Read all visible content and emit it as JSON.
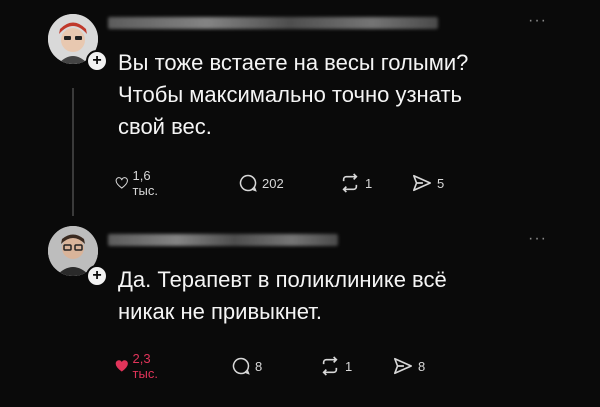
{
  "posts": [
    {
      "text_lines": [
        "Вы тоже встаете на весы голыми?",
        "Чтобы максимально точно узнать",
        "свой вес."
      ],
      "follow_symbol": "+",
      "more_symbol": "···",
      "actions": {
        "likes": "1,6 тыс.",
        "replies": "202",
        "reposts": "1",
        "shares": "5"
      },
      "liked": false
    },
    {
      "text_lines": [
        "Да. Терапевт в поликлинике всё",
        "никак не привыкнет."
      ],
      "follow_symbol": "+",
      "more_symbol": "···",
      "actions": {
        "likes": "2,3 тыс.",
        "replies": "8",
        "reposts": "1",
        "shares": "8"
      },
      "liked": true
    }
  ],
  "icons": {
    "like": "heart-icon",
    "reply": "comment-icon",
    "repost": "repost-icon",
    "share": "share-icon"
  },
  "colors": {
    "background": "#0a0a0a",
    "text": "#f5f5f5",
    "liked": "#e0345a"
  }
}
